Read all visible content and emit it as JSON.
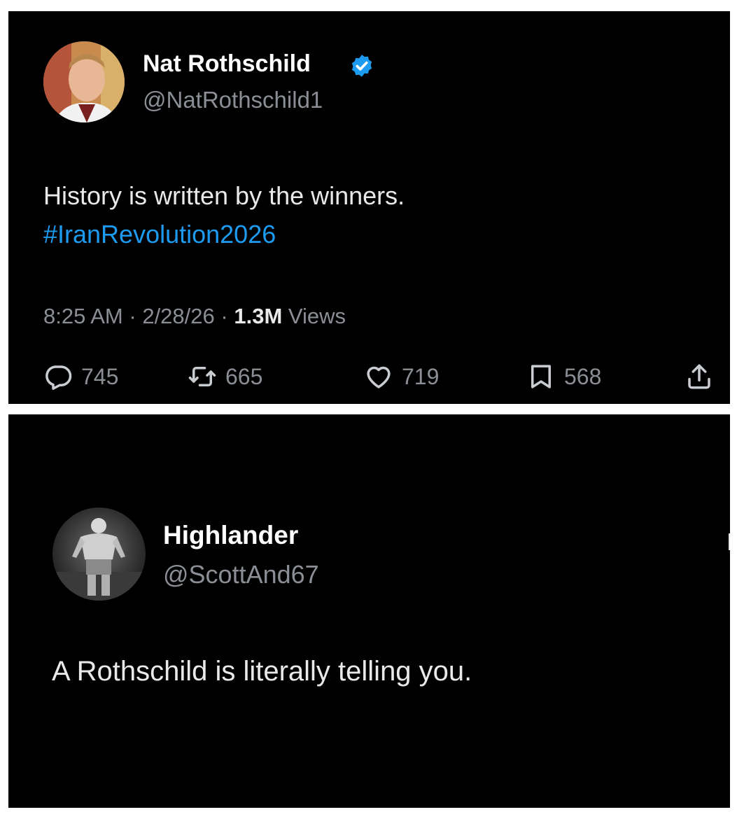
{
  "tweet": {
    "display_name": "Nat Rothschild",
    "handle": "@NatRothschild1",
    "verified_icon": "verified-badge-icon",
    "text_line1": "History is written by the winners.",
    "hashtag": "#IranRevolution2026",
    "time": "8:25 AM",
    "date": "2/28/26",
    "views_count": "1.3M",
    "views_label": "Views",
    "separator": "·",
    "actions": {
      "replies": "745",
      "reposts": "665",
      "likes": "719",
      "bookmarks": "568"
    }
  },
  "reply": {
    "display_name": "Highlander",
    "handle": "@ScottAnd67",
    "text": "A Rothschild is literally telling you."
  },
  "colors": {
    "background": "#000000",
    "text": "#e7e9ea",
    "muted": "#8b8f95",
    "accent": "#1d9bf0"
  }
}
